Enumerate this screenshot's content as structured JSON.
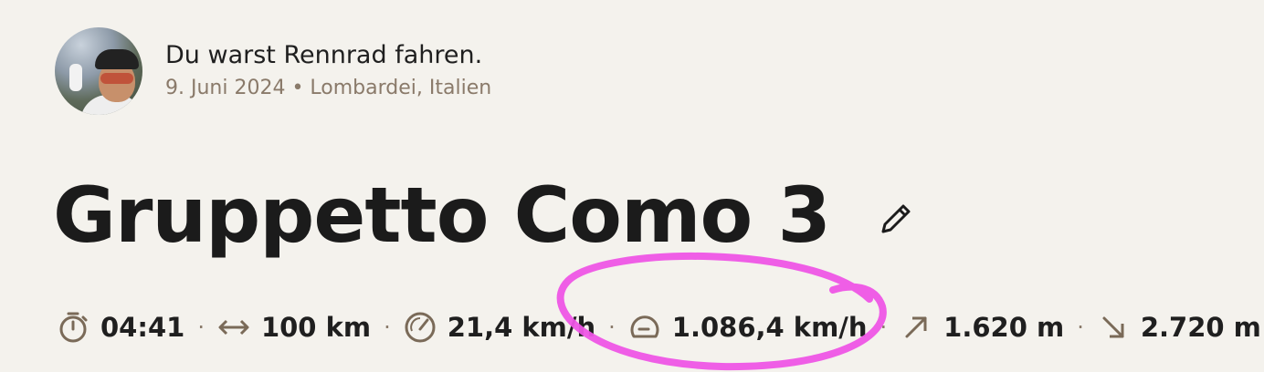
{
  "header": {
    "activity_text": "Du warst Rennrad fahren.",
    "date": "9. Juni 2024",
    "location": "Lombardei, Italien",
    "meta_separator": " • "
  },
  "title": "Gruppetto Como 3",
  "stats": [
    {
      "icon": "stopwatch-icon",
      "value": "04:41"
    },
    {
      "icon": "distance-arrows-icon",
      "value": "100 km"
    },
    {
      "icon": "speedometer-icon",
      "value": "21,4 km/h"
    },
    {
      "icon": "max-speed-gauge-icon",
      "value": "1.086,4 km/h"
    },
    {
      "icon": "ascent-arrow-icon",
      "value": "1.620 m"
    },
    {
      "icon": "descent-arrow-icon",
      "value": "2.720 m"
    }
  ],
  "separator": "·",
  "colors": {
    "background": "#f4f2ed",
    "text": "#1b1b1b",
    "meta_text": "#8a7a6a",
    "icon": "#7a6a58",
    "annotation": "#ee55e6"
  }
}
